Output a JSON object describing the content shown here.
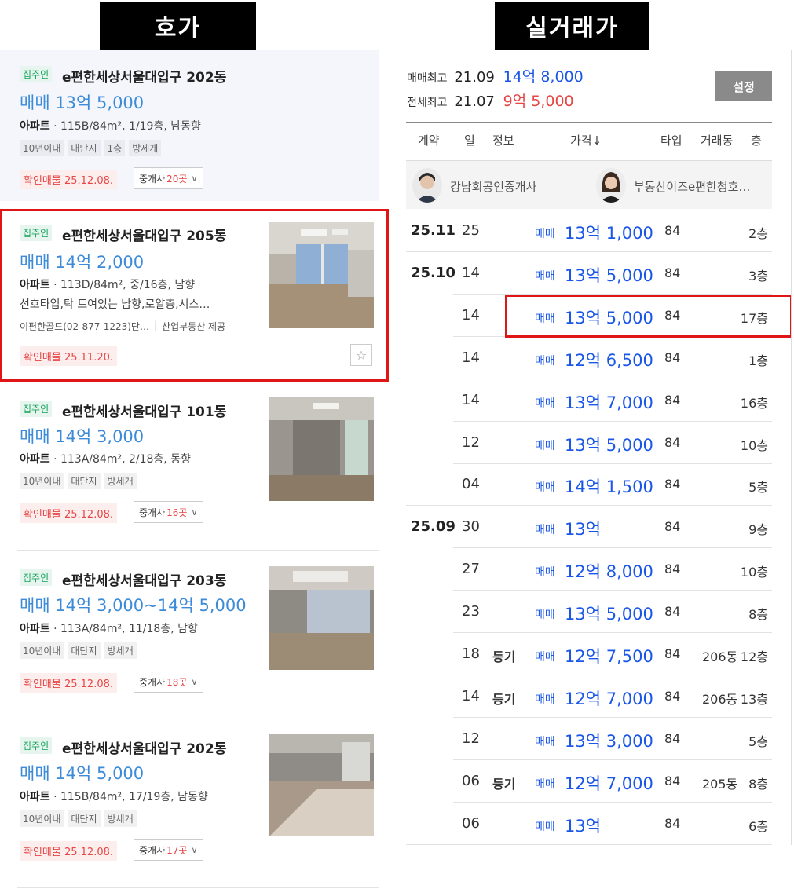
{
  "captions": {
    "left": "호가",
    "right": "실거래가"
  },
  "listings": [
    {
      "badge": "집주인",
      "title": "e편한세상서울대입구 202동",
      "price": "매매 13억 5,000",
      "type": "아파트",
      "spec": " · 115B/84m², 1/19층, 남동향",
      "tags": [
        "10년이내",
        "대단지",
        "1층",
        "방세개"
      ],
      "confirm": "확인매물 25.12.08.",
      "broker_label": "중개사",
      "broker_count": "20곳"
    },
    {
      "badge": "집주인",
      "title": "e편한세상서울대입구 205동",
      "price": "매매 14억 2,000",
      "type": "아파트",
      "spec": " · 113D/84m², 중/16층, 남향",
      "desc": "선호타입,탁 트여있는 남향,로얄층,시스…",
      "agency": "이편한골드(02-877-1223)단…",
      "agency2": "산업부동산 제공",
      "confirm": "확인매물 25.11.20."
    },
    {
      "badge": "집주인",
      "title": "e편한세상서울대입구 101동",
      "price": "매매 14억 3,000",
      "type": "아파트",
      "spec": " · 113A/84m², 2/18층, 동향",
      "tags": [
        "10년이내",
        "대단지",
        "방세개"
      ],
      "confirm": "확인매물 25.12.08.",
      "broker_label": "중개사",
      "broker_count": "16곳"
    },
    {
      "badge": "집주인",
      "title": "e편한세상서울대입구 203동",
      "price": "매매 14억 3,000~14억 5,000",
      "type": "아파트",
      "spec": " · 113A/84m², 11/18층, 남향",
      "tags": [
        "10년이내",
        "대단지",
        "방세개"
      ],
      "confirm": "확인매물 25.12.08.",
      "broker_label": "중개사",
      "broker_count": "18곳"
    },
    {
      "badge": "집주인",
      "title": "e편한세상서울대입구 202동",
      "price": "매매 14억 5,000",
      "type": "아파트",
      "spec": " · 115B/84m², 17/19층, 남동향",
      "tags": [
        "10년이내",
        "대단지",
        "방세개"
      ],
      "confirm": "확인매물 25.12.08.",
      "broker_label": "중개사",
      "broker_count": "17곳"
    }
  ],
  "trade": {
    "summary": {
      "sale_label": "매매최고",
      "sale_date": "21.09",
      "sale_price": "14억 8,000",
      "jeonse_label": "전세최고",
      "jeonse_date": "21.07",
      "jeonse_price": "9억 5,000"
    },
    "settings_label": "설정",
    "headers": {
      "contract": "계약",
      "day": "일",
      "info": "정보",
      "price": "가격↓",
      "type": "타입",
      "dong": "거래동",
      "floor": "층"
    },
    "agents": [
      "강남회공인중개사",
      "부동산이즈e편한청호…"
    ],
    "rows": [
      {
        "ym": "25.11",
        "day": "25",
        "info": "",
        "kind": "매매",
        "price": "13억 1,000",
        "type": "84",
        "dong": "",
        "floor": "2층"
      },
      {
        "ym": "25.10",
        "day": "14",
        "info": "",
        "kind": "매매",
        "price": "13억 5,000",
        "type": "84",
        "dong": "",
        "floor": "3층"
      },
      {
        "ym": "",
        "day": "14",
        "info": "",
        "kind": "매매",
        "price": "13억 5,000",
        "type": "84",
        "dong": "",
        "floor": "17층"
      },
      {
        "ym": "",
        "day": "14",
        "info": "",
        "kind": "매매",
        "price": "12억 6,500",
        "type": "84",
        "dong": "",
        "floor": "1층"
      },
      {
        "ym": "",
        "day": "14",
        "info": "",
        "kind": "매매",
        "price": "13억 7,000",
        "type": "84",
        "dong": "",
        "floor": "16층"
      },
      {
        "ym": "",
        "day": "12",
        "info": "",
        "kind": "매매",
        "price": "13억 5,000",
        "type": "84",
        "dong": "",
        "floor": "10층"
      },
      {
        "ym": "",
        "day": "04",
        "info": "",
        "kind": "매매",
        "price": "14억 1,500",
        "type": "84",
        "dong": "",
        "floor": "5층"
      },
      {
        "ym": "25.09",
        "day": "30",
        "info": "",
        "kind": "매매",
        "price": "13억",
        "type": "84",
        "dong": "",
        "floor": "9층"
      },
      {
        "ym": "",
        "day": "27",
        "info": "",
        "kind": "매매",
        "price": "12억 8,000",
        "type": "84",
        "dong": "",
        "floor": "10층"
      },
      {
        "ym": "",
        "day": "23",
        "info": "",
        "kind": "매매",
        "price": "13억 5,000",
        "type": "84",
        "dong": "",
        "floor": "8층"
      },
      {
        "ym": "",
        "day": "18",
        "info": "등기",
        "kind": "매매",
        "price": "12억 7,500",
        "type": "84",
        "dong": "206동",
        "floor": "12층"
      },
      {
        "ym": "",
        "day": "14",
        "info": "등기",
        "kind": "매매",
        "price": "12억 7,000",
        "type": "84",
        "dong": "206동",
        "floor": "13층"
      },
      {
        "ym": "",
        "day": "12",
        "info": "",
        "kind": "매매",
        "price": "13억 3,000",
        "type": "84",
        "dong": "",
        "floor": "5층"
      },
      {
        "ym": "",
        "day": "06",
        "info": "등기",
        "kind": "매매",
        "price": "12억 7,000",
        "type": "84",
        "dong": "205동",
        "floor": "8층"
      },
      {
        "ym": "",
        "day": "06",
        "info": "",
        "kind": "매매",
        "price": "13억",
        "type": "84",
        "dong": "",
        "floor": "6층"
      }
    ]
  }
}
